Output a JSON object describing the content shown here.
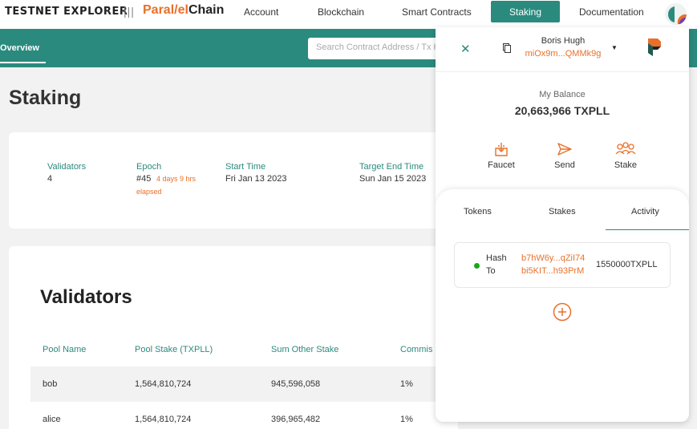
{
  "header": {
    "brand": "TESTNET EXPLORER",
    "separator": "|||",
    "logo_part1": "Paral",
    "logo_slash": "/",
    "logo_part2": "el",
    "logo_part3": "Chain",
    "nav": [
      "Account",
      "Blockchain",
      "Smart Contracts",
      "Staking",
      "Documentation"
    ],
    "active_nav": "Staking"
  },
  "subnav": {
    "overview": "Overview",
    "search_placeholder": "Search Contract Address / Tx Hash"
  },
  "page": {
    "title": "Staking",
    "stats": {
      "validators_label": "Validators",
      "validators_value": "4",
      "epoch_label": "Epoch",
      "epoch_value": "#45",
      "epoch_elapsed": "4 days 9 hrs",
      "epoch_elapsed_2": "elapsed",
      "start_label": "Start Time",
      "start_value": "Fri Jan 13 2023",
      "end_label": "Target End Time",
      "end_value": "Sun Jan 15 2023"
    },
    "validators": {
      "title": "Validators",
      "columns": [
        "Pool Name",
        "Pool Stake (TXPLL)",
        "Sum Other Stake",
        "Commis"
      ],
      "rows": [
        [
          "bob",
          "1,564,810,724",
          "945,596,058",
          "1%"
        ],
        [
          "alice",
          "1,564,810,724",
          "396,965,482",
          "1%"
        ]
      ]
    }
  },
  "wallet": {
    "account_name": "Boris Hugh",
    "account_address": "miOx9m...QMMk9g",
    "balance_label": "My Balance",
    "balance_value": "20,663,966 TXPLL",
    "actions": [
      "Faucet",
      "Send",
      "Stake"
    ],
    "tabs": [
      "Tokens",
      "Stakes",
      "Activity"
    ],
    "active_tab": "Activity",
    "activity": [
      {
        "hash_label": "Hash",
        "hash_value": "b7hW6y...qZiI74",
        "to_label": "To",
        "to_value": "bi5KIT...h93PrM",
        "amount": "1550000TXPLL",
        "status_color": "#1aa51a"
      }
    ]
  },
  "colors": {
    "primary": "#2b8a7e",
    "accent": "#e8702a"
  }
}
